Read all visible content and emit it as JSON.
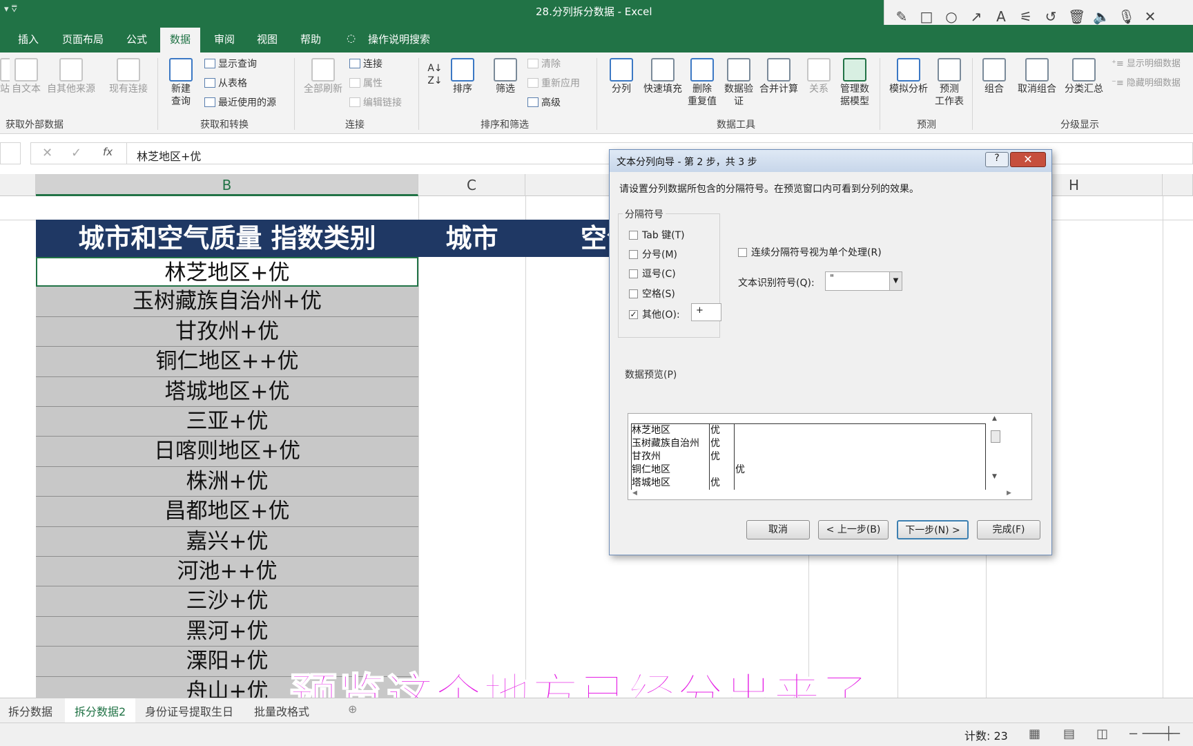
{
  "window": {
    "title": "28.分列拆分数据  -  Excel",
    "qa": "▾  ⩢"
  },
  "drawtools": [
    "✎",
    "□",
    "○",
    "↗",
    "A",
    "⚟",
    "↺",
    "🗑",
    "🔈",
    "🎙",
    "✕"
  ],
  "tabs": [
    "插入",
    "页面布局",
    "公式",
    "数据",
    "审阅",
    "视图",
    "帮助",
    "操作说明搜索"
  ],
  "ribbon": {
    "ext": {
      "a": "站",
      "b": "自文本",
      "c": "自其他来源",
      "d": "现有连接",
      "group": "获取外部数据"
    },
    "get": {
      "new_query": "新建\n查询",
      "show_query": "显示查询",
      "from_table": "从表格",
      "recent": "最近使用的源",
      "group": "获取和转换"
    },
    "conn": {
      "refresh": "全部刷新",
      "connections": "连接",
      "properties": "属性",
      "edit_links": "编辑链接",
      "group": "连接"
    },
    "sort": {
      "sort": "排序",
      "filter": "筛选",
      "clear": "清除",
      "reapply": "重新应用",
      "advanced": "高级",
      "group": "排序和筛选"
    },
    "tools": {
      "split": "分列",
      "flash": "快速填充",
      "dup": "删除\n重复值",
      "valid": "数据验\n证",
      "consolidate": "合并计算",
      "rel": "关系",
      "model": "管理数\n据模型",
      "group": "数据工具"
    },
    "forecast": {
      "whatif": "模拟分析",
      "sheet": "预测\n工作表",
      "group": "预测"
    },
    "outline": {
      "group_btn": "组合",
      "ungroup": "取消组合",
      "subtotal": "分类汇总",
      "show": "显示明细数据",
      "hide": "隐藏明细数据",
      "group": "分级显示"
    }
  },
  "formula": {
    "value": "林芝地区+优",
    "cancel": "✕",
    "enter": "✓",
    "fx": "fx"
  },
  "columns": [
    "B",
    "C",
    "H"
  ],
  "header": [
    "城市和空气质量 指数类别",
    "城市",
    "空气质量指数类别"
  ],
  "cells": [
    "林芝地区+优",
    "玉树藏族自治州+优",
    "甘孜州+优",
    "铜仁地区++优",
    "塔城地区+优",
    "三亚+优",
    "日喀则地区+优",
    "株洲+优",
    "昌都地区+优",
    "嘉兴+优",
    "河池++优",
    "三沙+优",
    "黑河+优",
    "溧阳+优",
    "舟山+优"
  ],
  "sheets": [
    "拆分数据",
    "拆分数据2",
    "身份证号提取生日",
    "批量改格式"
  ],
  "status": {
    "count": "计数: 23"
  },
  "subtitle": "预览这个地方已经分出来了",
  "dialog": {
    "title": "文本分列向导 - 第 2 步，共 3 步",
    "help": "?",
    "desc": "请设置分列数据所包含的分隔符号。在预览窗口内可看到分列的效果。",
    "delims_label": "分隔符号",
    "tab": "Tab 键(T)",
    "semicolon": "分号(M)",
    "comma": "逗号(C)",
    "space": "空格(S)",
    "other": "其他(O):",
    "other_value": "+",
    "consecutive": "连续分隔符号视为单个处理(R)",
    "qualifier_label": "文本识别符号(Q):",
    "qualifier_value": "\"",
    "preview_label": "数据预览(P)",
    "preview_rows": [
      [
        "林芝地区",
        "优",
        ""
      ],
      [
        "玉树藏族自治州",
        "优",
        ""
      ],
      [
        "甘孜州",
        "优",
        ""
      ],
      [
        "铜仁地区",
        "",
        "优"
      ],
      [
        "塔城地区",
        "优",
        ""
      ]
    ],
    "cancel": "取消",
    "back": "< 上一步(B)",
    "next": "下一步(N) >",
    "finish": "完成(F)"
  }
}
